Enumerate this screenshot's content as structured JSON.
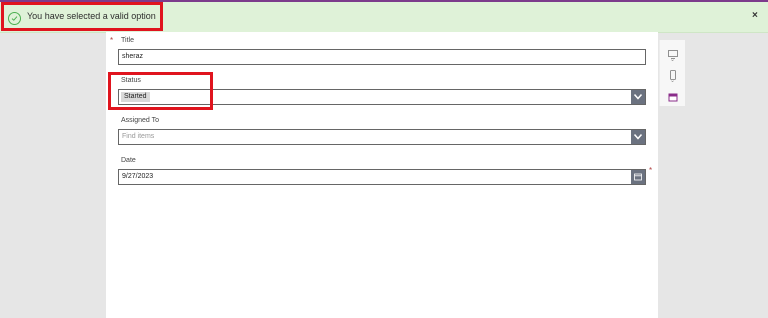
{
  "notification": {
    "message": "You have selected a valid option",
    "close_glyph": "×",
    "icon": "check-circle-icon"
  },
  "form": {
    "title": {
      "label": "Title",
      "value": "sheraz",
      "required_mark": "*"
    },
    "status": {
      "label": "Status",
      "selected": "Started"
    },
    "assigned_to": {
      "label": "Assigned To",
      "placeholder": "Find items"
    },
    "date": {
      "label": "Date",
      "value": "9/27/2023",
      "required_mark": "*"
    }
  },
  "side_panel": {
    "icons": [
      "monitor-icon",
      "phone-icon",
      "calendar-icon"
    ]
  },
  "colors": {
    "accent": "#7d3b8c",
    "notification_bg": "#dff2d8",
    "success": "#4caf50",
    "highlight": "#e0141e",
    "button": "#6b7280"
  }
}
